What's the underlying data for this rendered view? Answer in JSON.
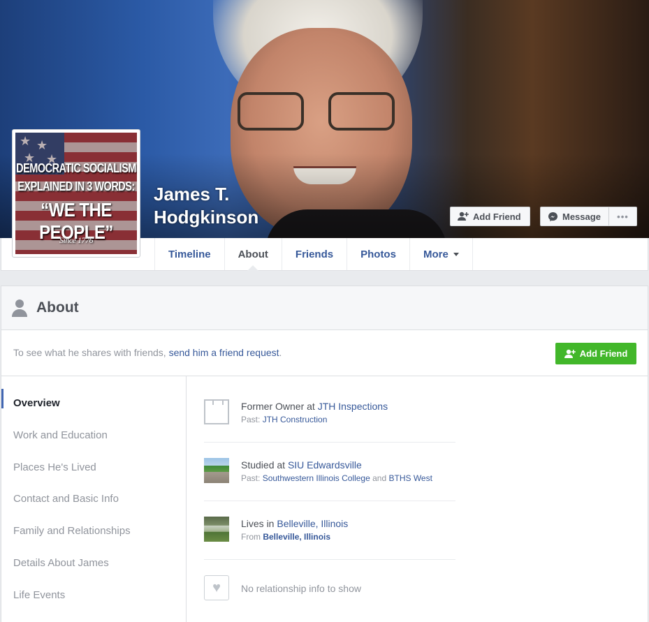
{
  "profile": {
    "name": "James T. Hodgkinson",
    "picture_text": {
      "line1": "DEMOCRATIC SOCIALISM",
      "line2": "EXPLAINED IN 3 WORDS:",
      "line3": "“WE THE PEOPLE”",
      "line4": "Since 1776"
    }
  },
  "cover_actions": {
    "add_friend": "Add Friend",
    "message": "Message",
    "more": "•••"
  },
  "tabs": [
    {
      "label": "Timeline"
    },
    {
      "label": "About",
      "active": true
    },
    {
      "label": "Friends"
    },
    {
      "label": "Photos"
    },
    {
      "label": "More"
    }
  ],
  "about": {
    "title": "About",
    "notice_prefix": "To see what he shares with friends, ",
    "notice_link": "send him a friend request",
    "notice_suffix": ".",
    "add_friend": "Add Friend",
    "sidebar": [
      {
        "label": "Overview",
        "active": true
      },
      {
        "label": "Work and Education"
      },
      {
        "label": "Places He's Lived"
      },
      {
        "label": "Contact and Basic Info"
      },
      {
        "label": "Family and Relationships"
      },
      {
        "label": "Details About James"
      },
      {
        "label": "Life Events"
      }
    ],
    "overview": {
      "work": {
        "prefix": "Former Owner at ",
        "link": "JTH Inspections",
        "past_label": "Past: ",
        "past_link": "JTH Construction"
      },
      "education": {
        "prefix": "Studied at ",
        "link": "SIU Edwardsville",
        "past_label": "Past: ",
        "past_link1": "Southwestern Illinois College",
        "past_and": " and ",
        "past_link2": "BTHS West"
      },
      "lives": {
        "prefix": "Lives in ",
        "link": "Belleville, Illinois",
        "from_label": "From ",
        "from_link": "Belleville, Illinois"
      },
      "relationship": "No relationship info to show"
    }
  },
  "colors": {
    "link": "#365899",
    "green_button": "#42b72a",
    "active_indicator": "#4267b2"
  }
}
